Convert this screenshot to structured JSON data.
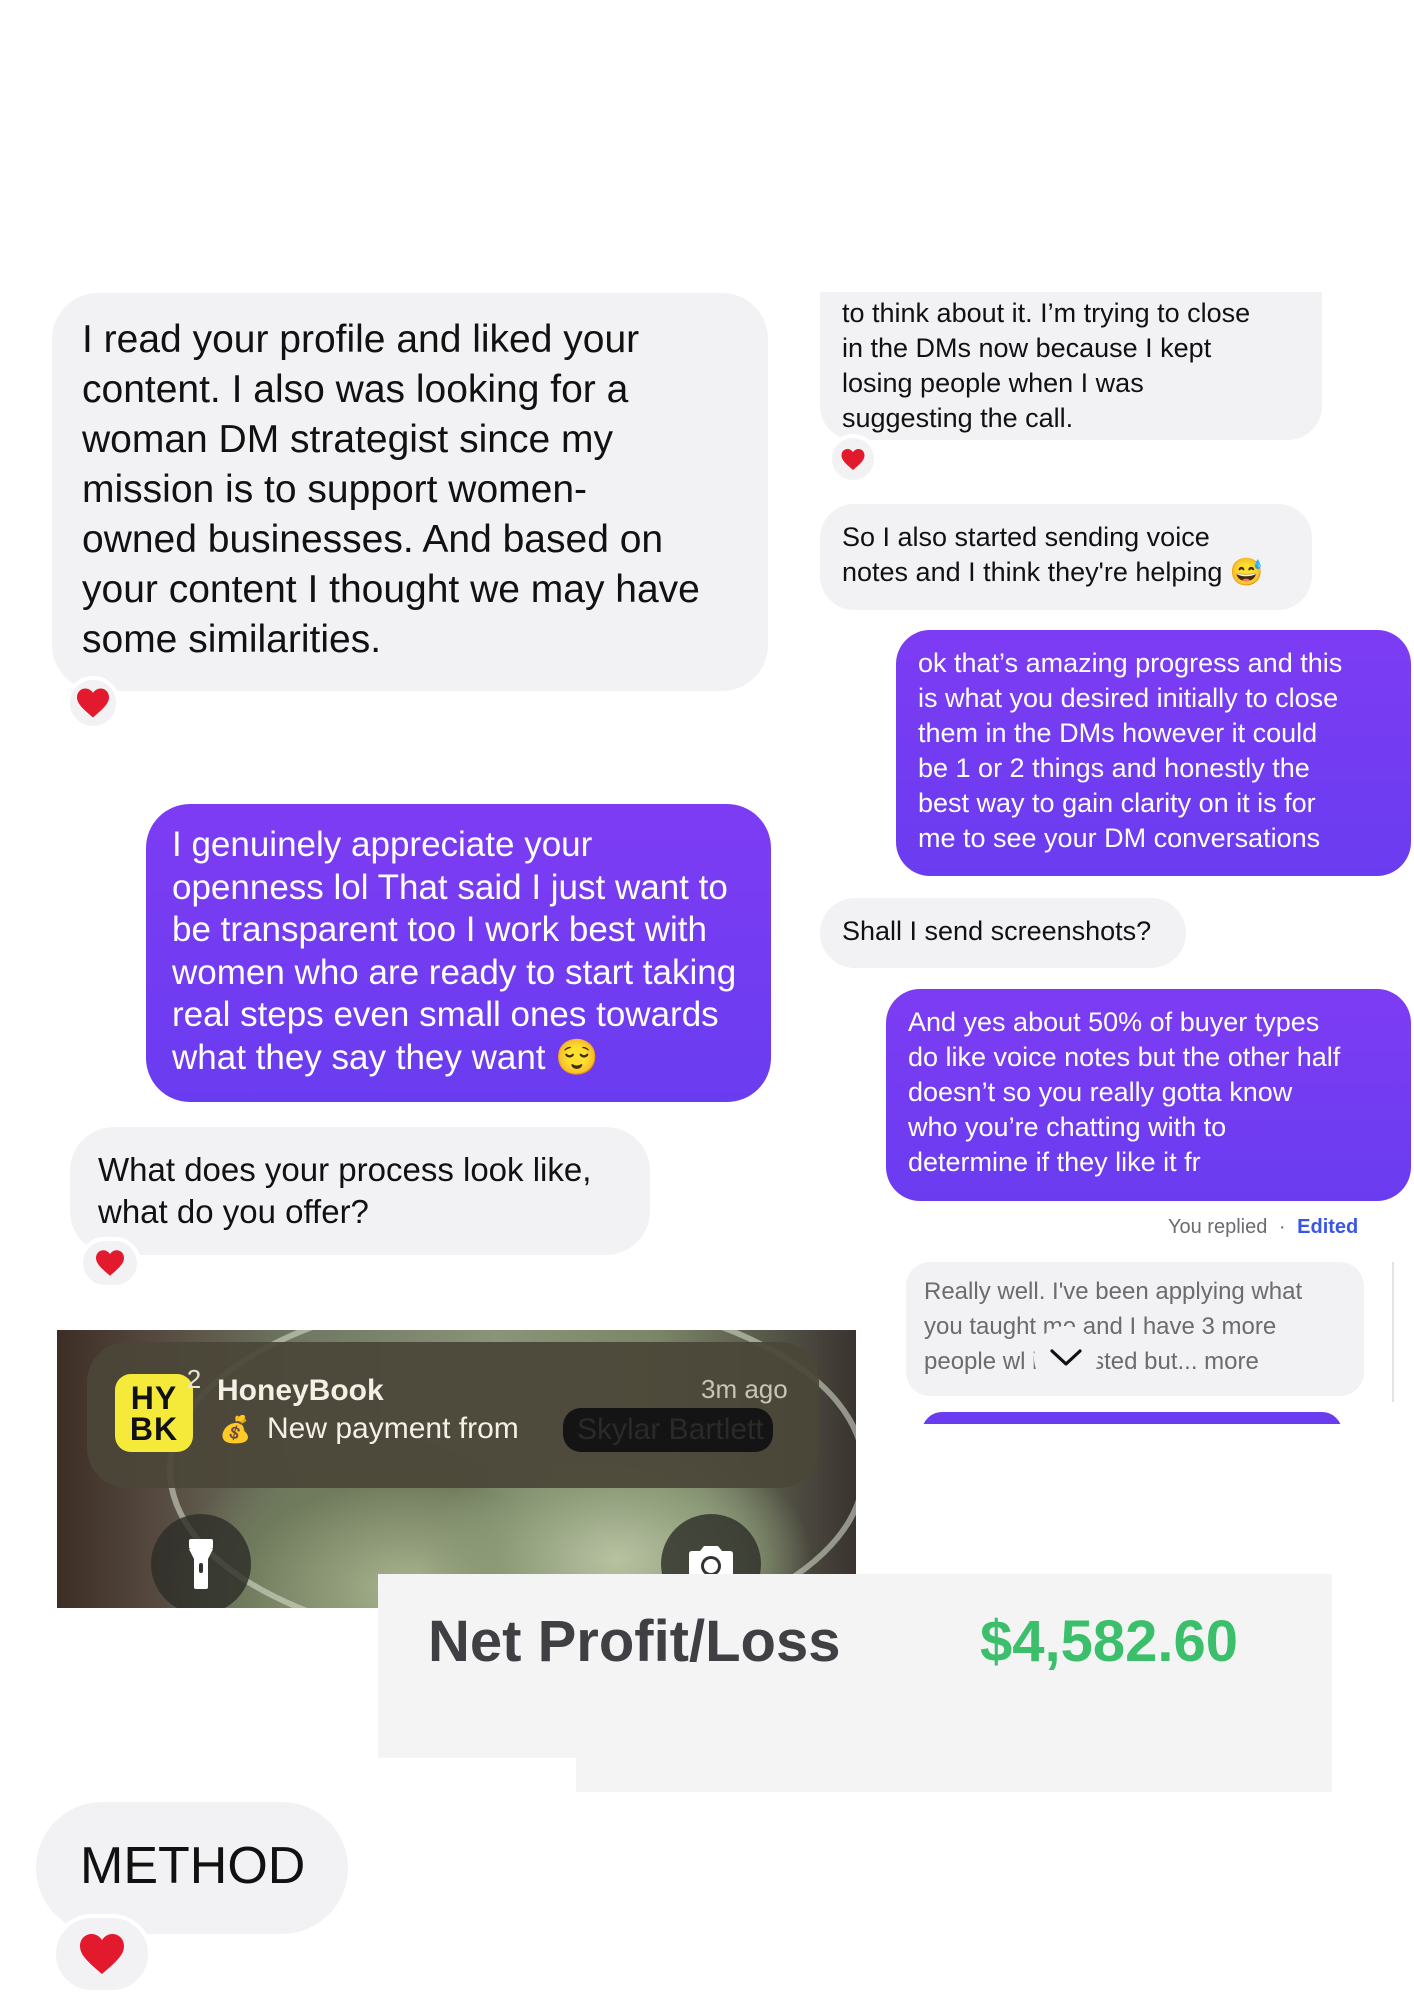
{
  "left_chat": {
    "msg1": "I read your profile and liked your\ncontent. I also was looking for a\nwoman DM strategist since my\nmission is to support women-\nowned businesses. And based on\nyour content I thought we may have\nsome similarities.",
    "msg2": "I genuinely appreciate your\nopenness lol That said I just want to\nbe transparent too I work best with\nwomen who are ready to start taking\nreal steps even small ones towards\nwhat they say they want 😌",
    "msg3": "What does your process look like,\nwhat do you offer?",
    "reaction_icon": "heart-icon"
  },
  "right_chat": {
    "msg1": "to think about it. I’m trying to close\nin the DMs now because I kept\nlosing people when I was\nsuggesting the call.",
    "msg2": "So I also started sending voice\nnotes and I think they're helping 😅",
    "msg3": "ok that’s amazing progress and this\nis what you desired initially to close\nthem in the DMs however it could\nbe 1 or 2 things and honestly the\nbest way to gain clarity on it is for\nme to see your DM conversations",
    "msg4": "Shall I send screenshots?",
    "msg5": "And yes about 50% of buyer types\ndo like voice notes but the other half\ndoesn’t so you really gotta know\nwho you’re chatting with to\ndetermine if they like it fr",
    "replied_label": "You replied",
    "separator": "·",
    "edited_label": "Edited",
    "quoted": "Really well. I've been applying what\nyou taught me and I have 3 more\npeople wl       interested but... more"
  },
  "notification": {
    "app_icon_text_top": "HY",
    "app_icon_text_bottom": "BK",
    "badge_count": "2",
    "app_name": "HoneyBook",
    "time": "3m ago",
    "emoji": "💰",
    "message": "New payment from",
    "redacted_name": "Skylar Bartlett"
  },
  "lockscreen": {
    "flashlight_icon": "flashlight-icon",
    "camera_icon": "camera-icon"
  },
  "profit": {
    "label": "Net Profit/Loss",
    "value": "$4,582.60",
    "value_color": "#3bbf6b"
  },
  "footer": {
    "method_label": "METHOD"
  }
}
